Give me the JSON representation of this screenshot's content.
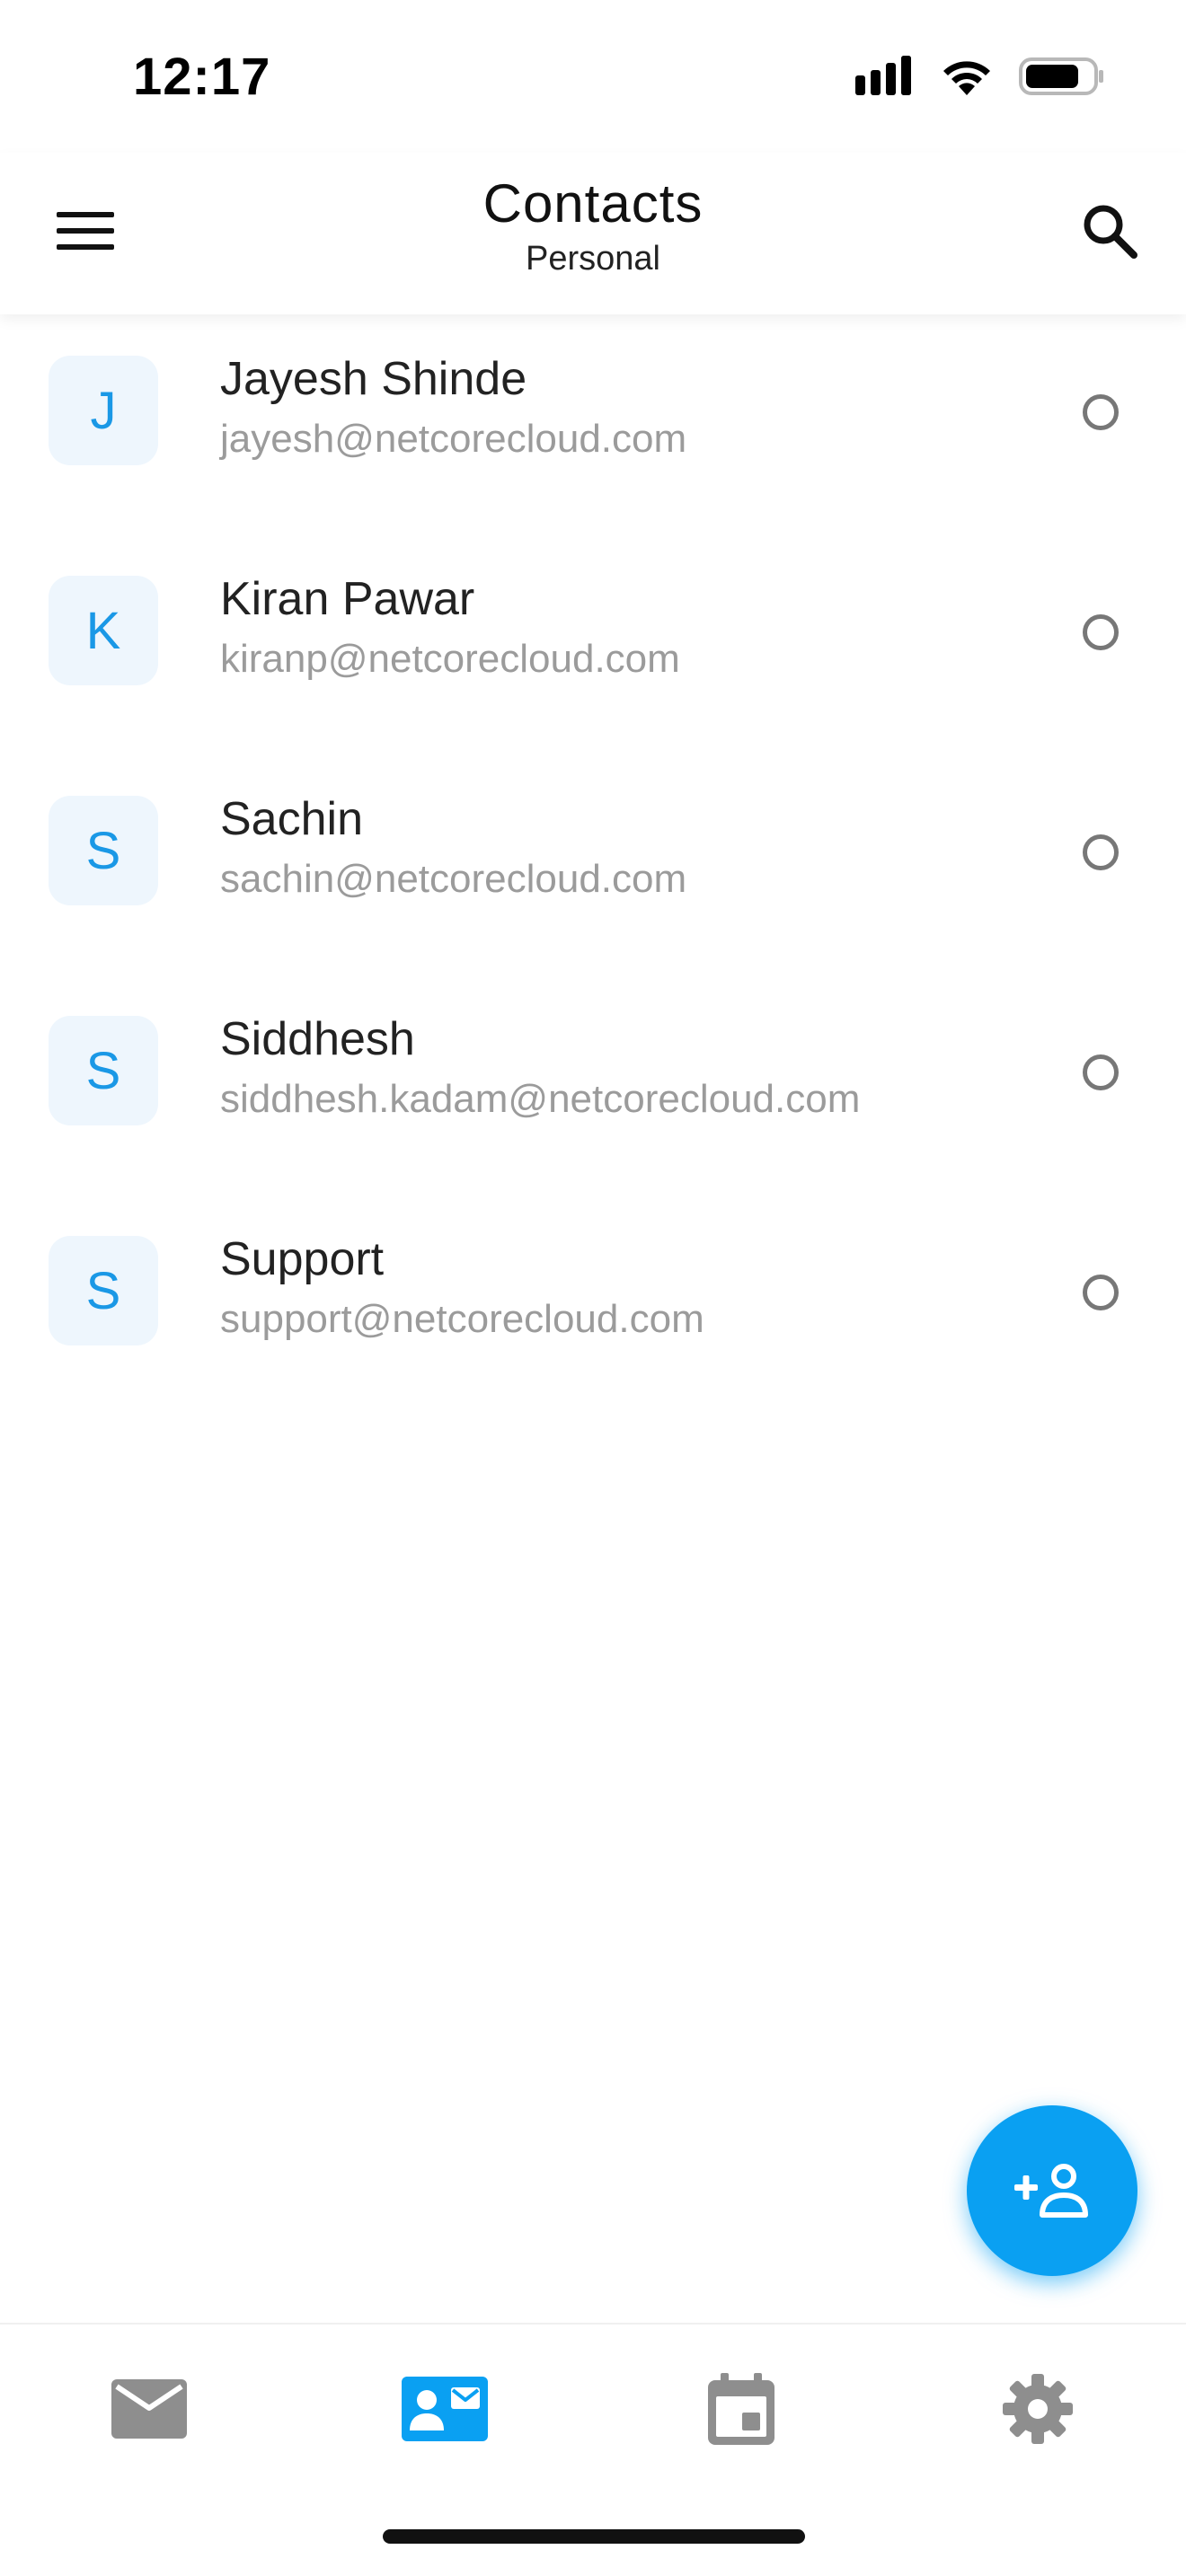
{
  "status_bar": {
    "time": "12:17"
  },
  "header": {
    "title": "Contacts",
    "subtitle": "Personal"
  },
  "contacts": [
    {
      "initial": "J",
      "name": "Jayesh Shinde",
      "email": "jayesh@netcorecloud.com"
    },
    {
      "initial": "K",
      "name": "Kiran Pawar",
      "email": "kiranp@netcorecloud.com"
    },
    {
      "initial": "S",
      "name": "Sachin",
      "email": "sachin@netcorecloud.com"
    },
    {
      "initial": "S",
      "name": "Siddhesh",
      "email": "siddhesh.kadam@netcorecloud.com"
    },
    {
      "initial": "S",
      "name": "Support",
      "email": "support@netcorecloud.com"
    }
  ],
  "icons": {
    "menu": "hamburger-menu-icon",
    "search": "search-icon",
    "fab": "add-person-icon",
    "nav": [
      "mail-icon",
      "contacts-icon",
      "calendar-icon",
      "gear-icon"
    ]
  },
  "colors": {
    "accent": "#0aa0f2",
    "avatar_bg": "#eef6fd",
    "avatar_text": "#1a98e6",
    "nav_inactive": "#8e8e8e",
    "email_text": "#9b9b9b"
  },
  "bottom_nav": {
    "active_index": 1
  }
}
